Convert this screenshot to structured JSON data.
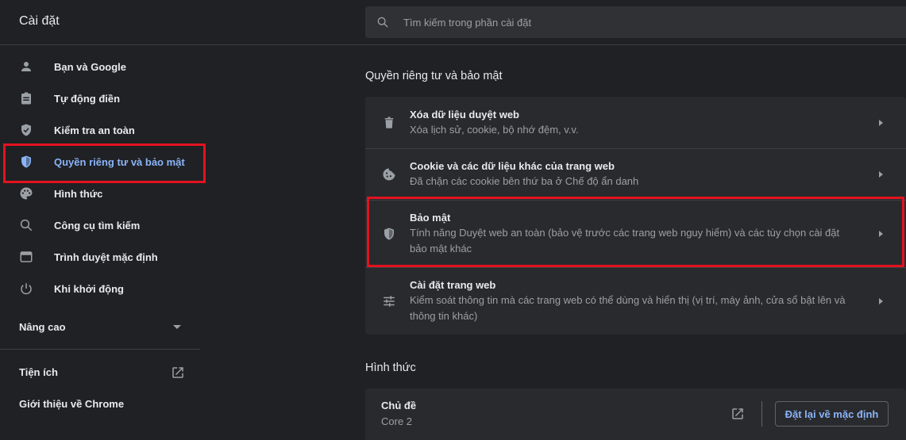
{
  "app": {
    "title": "Cài đặt"
  },
  "search": {
    "placeholder": "Tìm kiếm trong phần cài đặt"
  },
  "sidebar": {
    "items": [
      {
        "label": "Bạn và Google",
        "icon": "person-icon"
      },
      {
        "label": "Tự động điền",
        "icon": "clipboard-icon"
      },
      {
        "label": "Kiểm tra an toàn",
        "icon": "shield-check-icon"
      },
      {
        "label": "Quyền riêng tư và bảo mật",
        "icon": "shield-icon",
        "active": true
      },
      {
        "label": "Hình thức",
        "icon": "palette-icon"
      },
      {
        "label": "Công cụ tìm kiếm",
        "icon": "search-icon"
      },
      {
        "label": "Trình duyệt mặc định",
        "icon": "browser-icon"
      },
      {
        "label": "Khi khởi động",
        "icon": "power-icon"
      }
    ],
    "advanced_label": "Nâng cao",
    "extensions_label": "Tiện ích",
    "about_label": "Giới thiệu về Chrome"
  },
  "privacy": {
    "section_title": "Quyền riêng tư và bảo mật",
    "rows": [
      {
        "title": "Xóa dữ liệu duyệt web",
        "sub": "Xóa lịch sử, cookie, bộ nhớ đệm, v.v.",
        "icon": "trash-icon"
      },
      {
        "title": "Cookie và các dữ liệu khác của trang web",
        "sub": "Đã chặn các cookie bên thứ ba ở Chế độ ẩn danh",
        "icon": "cookie-icon"
      },
      {
        "title": "Bảo mật",
        "sub": "Tính năng Duyệt web an toàn (bảo vệ trước các trang web nguy hiểm) và các tùy chọn cài đặt bảo mật khác",
        "icon": "shield-icon"
      },
      {
        "title": "Cài đặt trang web",
        "sub": "Kiểm soát thông tin mà các trang web có thể dùng và hiển thị (vị trí, máy ảnh, cửa sổ bật lên và thông tin khác)",
        "icon": "sliders-icon"
      }
    ]
  },
  "appearance": {
    "section_title": "Hình thức",
    "theme_label": "Chủ đề",
    "theme_value": "Core 2",
    "reset_label": "Đặt lại về mặc định"
  },
  "colors": {
    "accent": "#8ab4f8",
    "highlight": "#e3121f",
    "background": "#202124",
    "card": "#292a2d"
  }
}
